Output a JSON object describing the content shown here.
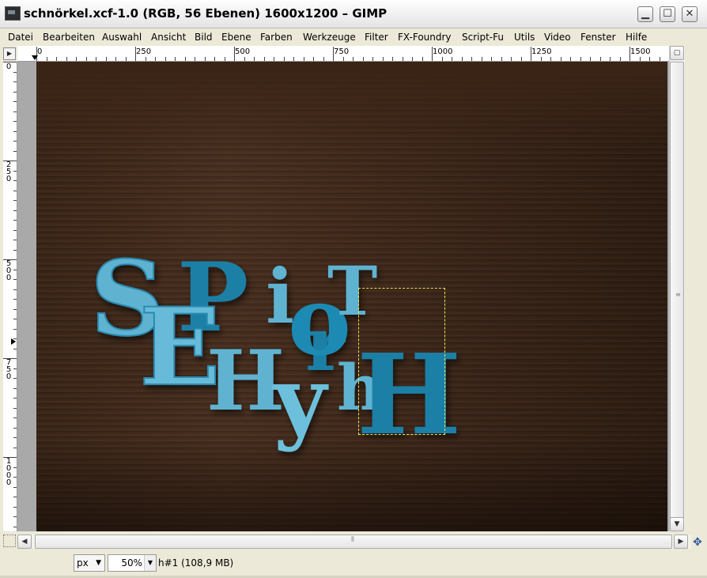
{
  "window": {
    "title": "schnörkel.xcf-1.0 (RGB, 56 Ebenen) 1600x1200 – GIMP",
    "minimize_icon": "minimize-icon",
    "maximize_icon": "maximize-icon",
    "close_icon": "close-icon"
  },
  "menubar": {
    "items": [
      {
        "label": "Datei"
      },
      {
        "label": "Bearbeiten"
      },
      {
        "label": "Auswahl"
      },
      {
        "label": "Ansicht"
      },
      {
        "label": "Bild"
      },
      {
        "label": "Ebene"
      },
      {
        "label": "Farben"
      },
      {
        "label": "Werkzeuge"
      },
      {
        "label": "Filter"
      },
      {
        "label": "FX-Foundry"
      },
      {
        "label": "Script-Fu"
      },
      {
        "label": "Utils"
      },
      {
        "label": "Video"
      },
      {
        "label": "Fenster"
      },
      {
        "label": "Hilfe"
      }
    ]
  },
  "ruler_h": {
    "labels": [
      "0",
      "250",
      "500",
      "750",
      "1000",
      "1250",
      "1500"
    ]
  },
  "ruler_v": {
    "labels": [
      "0",
      "250",
      "500",
      "750",
      "1000"
    ]
  },
  "artwork": {
    "letters": [
      "S",
      "P",
      "i",
      "E",
      "H",
      "y",
      "r",
      "o",
      "T",
      "h",
      "H"
    ],
    "colors": {
      "light": "#5fb3d1",
      "dark": "#1a7fa6",
      "wood": "#3e2718"
    }
  },
  "statusbar": {
    "unit": "px",
    "zoom": "50%",
    "info": "h#1 (108,9 MB)"
  },
  "colors": {
    "selection": "#e8e85a",
    "chrome": "#ece9d8"
  }
}
